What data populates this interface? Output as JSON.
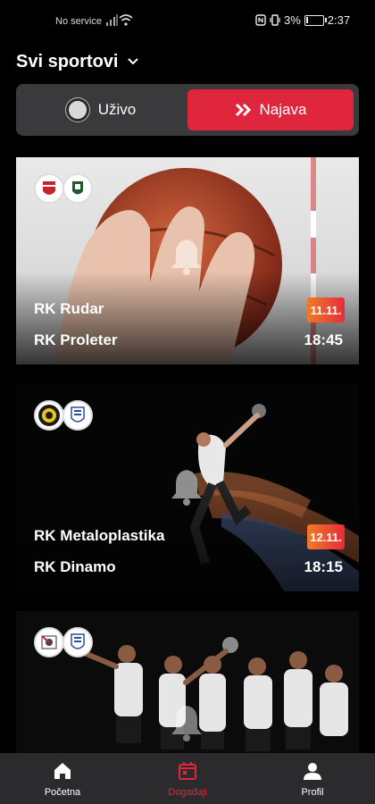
{
  "status_bar": {
    "carrier": "No service",
    "battery": "3%",
    "clock": "2:37"
  },
  "sport_filter": {
    "label": "Svi sportovi"
  },
  "mode_toggle": {
    "live_label": "Uživo",
    "upcoming_label": "Najava",
    "selected": "upcoming"
  },
  "events": [
    {
      "home": "RK Rudar",
      "away": "RK Proleter",
      "date": "11.11.",
      "time": "18:45"
    },
    {
      "home": "RK Metaloplastika",
      "away": "RK Dinamo",
      "date": "12.11.",
      "time": "18:15"
    },
    {
      "home": "",
      "away": "",
      "date": "",
      "time": ""
    }
  ],
  "bottom_nav": {
    "items": [
      {
        "label": "Početna",
        "icon": "home-icon",
        "active": false
      },
      {
        "label": "Događaji",
        "icon": "calendar-icon",
        "active": true
      },
      {
        "label": "Profil",
        "icon": "person-icon",
        "active": false
      }
    ]
  },
  "colors": {
    "accent": "#e0263c",
    "nav_bg": "#2b2b2d",
    "toggle_bg": "#3a3a3c"
  }
}
